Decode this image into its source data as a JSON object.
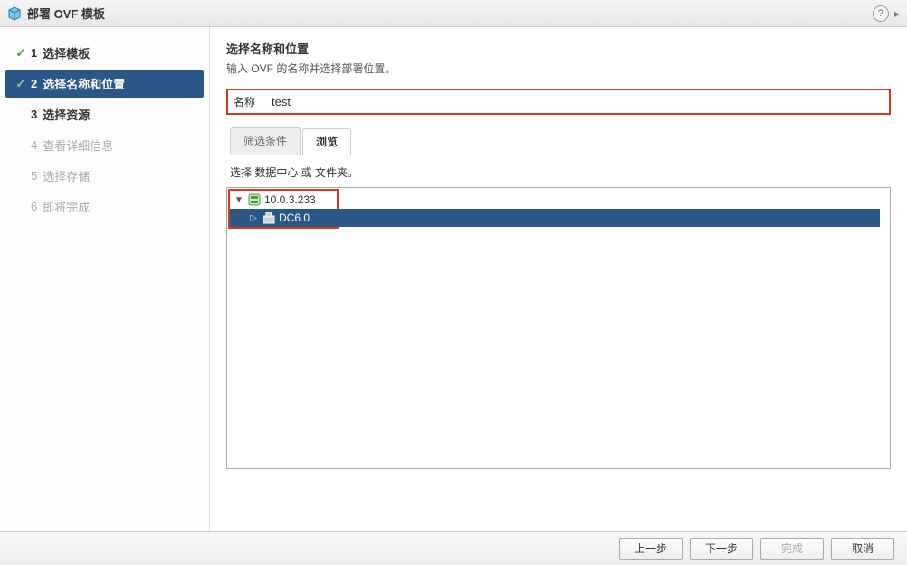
{
  "dialog": {
    "title": "部署 OVF 模板"
  },
  "steps": [
    {
      "num": "1",
      "label": "选择模板",
      "state": "completed"
    },
    {
      "num": "2",
      "label": "选择名称和位置",
      "state": "current"
    },
    {
      "num": "3",
      "label": "选择资源",
      "state": "pending"
    },
    {
      "num": "4",
      "label": "查看详细信息",
      "state": "disabled"
    },
    {
      "num": "5",
      "label": "选择存储",
      "state": "disabled"
    },
    {
      "num": "6",
      "label": "即将完成",
      "state": "disabled"
    }
  ],
  "section": {
    "title": "选择名称和位置",
    "subtitle": "输入 OVF 的名称并选择部署位置。"
  },
  "name_field": {
    "label": "名称",
    "value": "test"
  },
  "tabs": {
    "filter": "筛选条件",
    "browse": "浏览"
  },
  "browse_hint": "选择 数据中心 或 文件夹。",
  "tree": {
    "root": "10.0.3.233",
    "child": "DC6.0"
  },
  "buttons": {
    "back": "上一步",
    "next": "下一步",
    "finish": "完成",
    "cancel": "取消"
  },
  "help_glyph": "?"
}
